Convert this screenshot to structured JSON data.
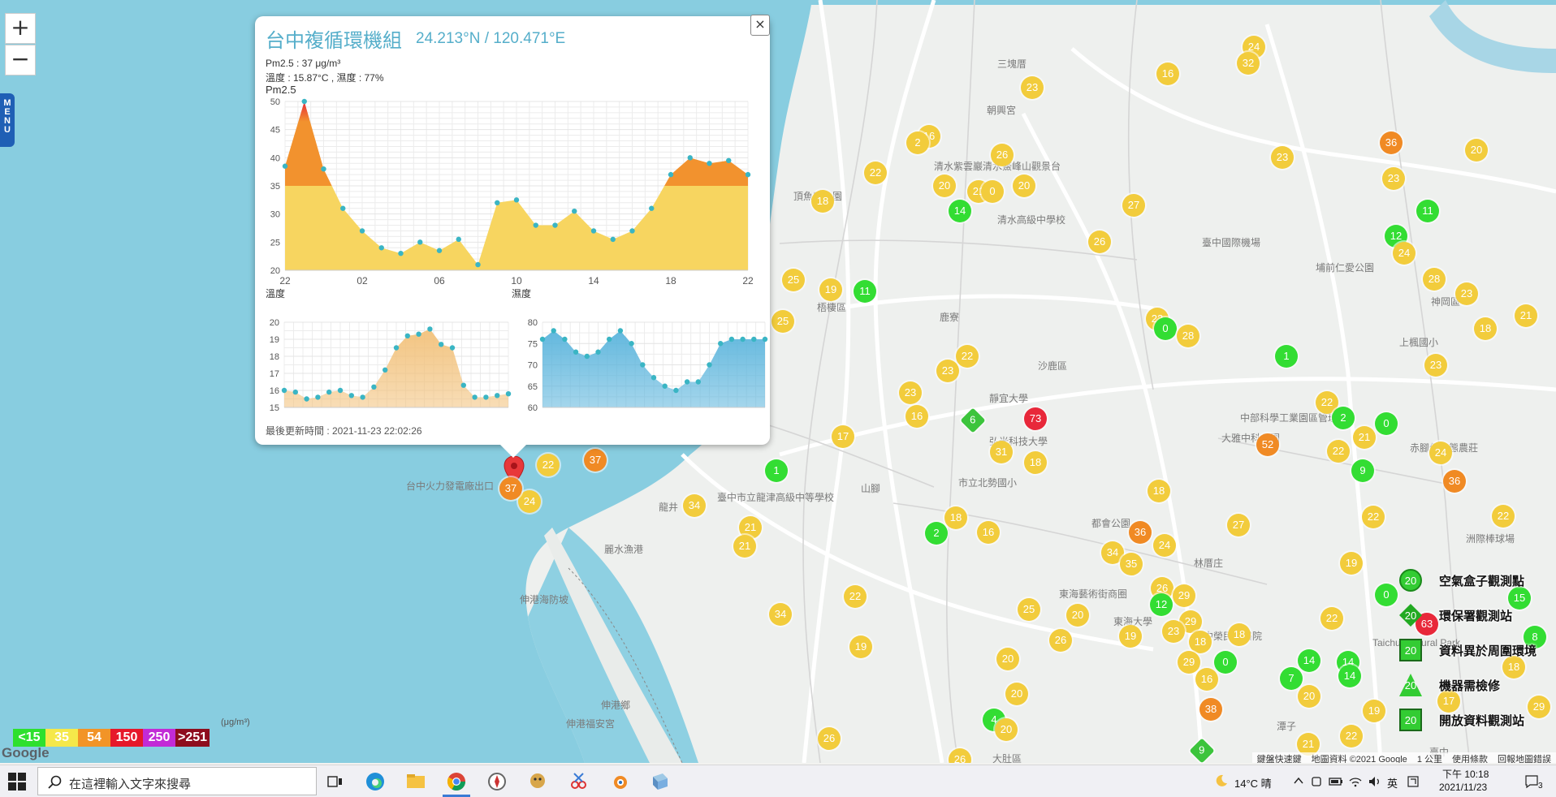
{
  "map": {
    "zoom_in": "+",
    "zoom_out": "−",
    "menu_tab": "MENU",
    "places": [
      {
        "t": "三塊厝",
        "x": 1228,
        "y": 70
      },
      {
        "t": "朝興宮",
        "x": 1215,
        "y": 127
      },
      {
        "t": "清水紫雲巖",
        "x": 1150,
        "y": 196
      },
      {
        "t": "清水鰲峰山觀景台",
        "x": 1210,
        "y": 196
      },
      {
        "t": "頂魚寮公園",
        "x": 977,
        "y": 233
      },
      {
        "t": "清水高級中學校",
        "x": 1228,
        "y": 262
      },
      {
        "t": "梧棲區",
        "x": 1006,
        "y": 370
      },
      {
        "t": "鹿寮",
        "x": 1157,
        "y": 382
      },
      {
        "t": "沙鹿區",
        "x": 1278,
        "y": 442
      },
      {
        "t": "靜宜大學",
        "x": 1218,
        "y": 482
      },
      {
        "t": "弘光科技大學",
        "x": 1218,
        "y": 535
      },
      {
        "t": "市立北勢國小",
        "x": 1180,
        "y": 586
      },
      {
        "t": "臺中國際機場",
        "x": 1480,
        "y": 290
      },
      {
        "t": "埔前仁愛公園",
        "x": 1620,
        "y": 321
      },
      {
        "t": "神岡區",
        "x": 1762,
        "y": 363
      },
      {
        "t": "上楓國小",
        "x": 1723,
        "y": 413
      },
      {
        "t": "中部科學工業園區管理局",
        "x": 1527,
        "y": 506
      },
      {
        "t": "大雅中科公園",
        "x": 1504,
        "y": 531
      },
      {
        "t": "赤腳仔生態農莊",
        "x": 1736,
        "y": 543
      },
      {
        "t": "台中火力發電廠出口",
        "x": 500,
        "y": 590
      },
      {
        "t": "龍井",
        "x": 811,
        "y": 616
      },
      {
        "t": "臺中市立龍津高級中等學校",
        "x": 883,
        "y": 604
      },
      {
        "t": "山腳",
        "x": 1060,
        "y": 593
      },
      {
        "t": "都會公園",
        "x": 1344,
        "y": 636
      },
      {
        "t": "麗水漁港",
        "x": 744,
        "y": 668
      },
      {
        "t": "林厝庄",
        "x": 1470,
        "y": 685
      },
      {
        "t": "洲際棒球場",
        "x": 1805,
        "y": 655
      },
      {
        "t": "東海藝術街商圈",
        "x": 1304,
        "y": 723
      },
      {
        "t": "東海大學",
        "x": 1371,
        "y": 757
      },
      {
        "t": "臺中榮民總醫院",
        "x": 1470,
        "y": 775
      },
      {
        "t": "Taichung Rural Park",
        "x": 1690,
        "y": 785
      },
      {
        "t": "伸港海防坡",
        "x": 640,
        "y": 730
      },
      {
        "t": "伸港鄉",
        "x": 740,
        "y": 860
      },
      {
        "t": "伸港福安宮",
        "x": 697,
        "y": 883
      },
      {
        "t": "大肚區",
        "x": 1222,
        "y": 926
      },
      {
        "t": "潭子",
        "x": 1572,
        "y": 886
      },
      {
        "t": "臺中",
        "x": 1760,
        "y": 918
      }
    ],
    "markers": [
      {
        "v": "24",
        "c": "y",
        "x": 1544,
        "y": 58
      },
      {
        "v": "32",
        "c": "y",
        "x": 1537,
        "y": 78
      },
      {
        "v": "16",
        "c": "y",
        "x": 1438,
        "y": 91
      },
      {
        "v": "23",
        "c": "y",
        "x": 1271,
        "y": 108
      },
      {
        "v": "16",
        "c": "y",
        "x": 1144,
        "y": 168
      },
      {
        "v": "2",
        "c": "y",
        "x": 1130,
        "y": 176
      },
      {
        "v": "26",
        "c": "y",
        "x": 1234,
        "y": 191
      },
      {
        "v": "36",
        "c": "o",
        "x": 1713,
        "y": 176
      },
      {
        "v": "20",
        "c": "y",
        "x": 1818,
        "y": 185
      },
      {
        "v": "23",
        "c": "y",
        "x": 1579,
        "y": 194
      },
      {
        "v": "22",
        "c": "y",
        "x": 1078,
        "y": 213
      },
      {
        "v": "20",
        "c": "y",
        "x": 1163,
        "y": 229
      },
      {
        "v": "21",
        "c": "y",
        "x": 1205,
        "y": 236
      },
      {
        "v": "0",
        "c": "y",
        "x": 1222,
        "y": 236
      },
      {
        "v": "20",
        "c": "y",
        "x": 1261,
        "y": 229
      },
      {
        "v": "23",
        "c": "y",
        "x": 1716,
        "y": 220
      },
      {
        "v": "18",
        "c": "y",
        "x": 1013,
        "y": 248
      },
      {
        "v": "14",
        "c": "g",
        "x": 1182,
        "y": 260
      },
      {
        "v": "27",
        "c": "y",
        "x": 1396,
        "y": 253
      },
      {
        "v": "11",
        "c": "g",
        "x": 1758,
        "y": 260
      },
      {
        "v": "26",
        "c": "y",
        "x": 1354,
        "y": 298
      },
      {
        "v": "12",
        "c": "g",
        "x": 1719,
        "y": 291
      },
      {
        "v": "24",
        "c": "y",
        "x": 1729,
        "y": 312
      },
      {
        "v": "28",
        "c": "y",
        "x": 1766,
        "y": 344
      },
      {
        "v": "23",
        "c": "y",
        "x": 1806,
        "y": 362
      },
      {
        "v": "21",
        "c": "y",
        "x": 1879,
        "y": 389
      },
      {
        "v": "18",
        "c": "y",
        "x": 1829,
        "y": 405
      },
      {
        "v": "25",
        "c": "y",
        "x": 977,
        "y": 345
      },
      {
        "v": "19",
        "c": "y",
        "x": 1023,
        "y": 357
      },
      {
        "v": "11",
        "c": "g",
        "x": 1065,
        "y": 359
      },
      {
        "v": "25",
        "c": "y",
        "x": 964,
        "y": 396
      },
      {
        "v": "22",
        "c": "y",
        "x": 1425,
        "y": 393
      },
      {
        "v": "0",
        "c": "g",
        "x": 1435,
        "y": 405
      },
      {
        "v": "28",
        "c": "y",
        "x": 1463,
        "y": 414
      },
      {
        "v": "1",
        "c": "g",
        "x": 1584,
        "y": 439
      },
      {
        "v": "22",
        "c": "y",
        "x": 1191,
        "y": 439
      },
      {
        "v": "23",
        "c": "y",
        "x": 1167,
        "y": 457
      },
      {
        "v": "23",
        "c": "y",
        "x": 1768,
        "y": 450
      },
      {
        "v": "23",
        "c": "y",
        "x": 1121,
        "y": 484
      },
      {
        "v": "22",
        "c": "y",
        "x": 1634,
        "y": 496
      },
      {
        "v": "16",
        "c": "y",
        "x": 1129,
        "y": 513
      },
      {
        "v": "2",
        "c": "g",
        "x": 1654,
        "y": 515
      },
      {
        "v": "0",
        "c": "g",
        "x": 1707,
        "y": 522
      },
      {
        "v": "73",
        "c": "r",
        "x": 1275,
        "y": 516
      },
      {
        "v": "21",
        "c": "y",
        "x": 1680,
        "y": 539
      },
      {
        "v": "52",
        "c": "o",
        "x": 1561,
        "y": 548
      },
      {
        "v": "17",
        "c": "y",
        "x": 1038,
        "y": 538
      },
      {
        "v": "22",
        "c": "y",
        "x": 1648,
        "y": 556
      },
      {
        "v": "24",
        "c": "y",
        "x": 1774,
        "y": 558
      },
      {
        "v": "31",
        "c": "y",
        "x": 1233,
        "y": 557
      },
      {
        "v": "18",
        "c": "y",
        "x": 1275,
        "y": 570
      },
      {
        "v": "9",
        "c": "g",
        "x": 1678,
        "y": 580
      },
      {
        "v": "36",
        "c": "o",
        "x": 1791,
        "y": 593
      },
      {
        "v": "1",
        "c": "g",
        "x": 956,
        "y": 580
      },
      {
        "v": "22",
        "c": "y",
        "x": 675,
        "y": 573
      },
      {
        "v": "37",
        "c": "o",
        "x": 733,
        "y": 567
      },
      {
        "v": "18",
        "c": "y",
        "x": 1427,
        "y": 605
      },
      {
        "v": "22",
        "c": "y",
        "x": 1691,
        "y": 637
      },
      {
        "v": "22",
        "c": "y",
        "x": 1851,
        "y": 636
      },
      {
        "v": "34",
        "c": "y",
        "x": 855,
        "y": 623
      },
      {
        "v": "24",
        "c": "y",
        "x": 652,
        "y": 618
      },
      {
        "v": "18",
        "c": "y",
        "x": 1177,
        "y": 638
      },
      {
        "v": "27",
        "c": "y",
        "x": 1525,
        "y": 647
      },
      {
        "v": "36",
        "c": "o",
        "x": 1404,
        "y": 656
      },
      {
        "v": "21",
        "c": "y",
        "x": 924,
        "y": 650
      },
      {
        "v": "2",
        "c": "g",
        "x": 1153,
        "y": 657
      },
      {
        "v": "16",
        "c": "y",
        "x": 1217,
        "y": 656
      },
      {
        "v": "21",
        "c": "y",
        "x": 917,
        "y": 673
      },
      {
        "v": "34",
        "c": "y",
        "x": 1370,
        "y": 681
      },
      {
        "v": "24",
        "c": "y",
        "x": 1434,
        "y": 672
      },
      {
        "v": "35",
        "c": "y",
        "x": 1393,
        "y": 695
      },
      {
        "v": "19",
        "c": "y",
        "x": 1664,
        "y": 694
      },
      {
        "v": "26",
        "c": "y",
        "x": 1431,
        "y": 725
      },
      {
        "v": "29",
        "c": "y",
        "x": 1458,
        "y": 734
      },
      {
        "v": "0",
        "c": "g",
        "x": 1707,
        "y": 733
      },
      {
        "v": "15",
        "c": "g",
        "x": 1871,
        "y": 737
      },
      {
        "v": "22",
        "c": "y",
        "x": 1053,
        "y": 735
      },
      {
        "v": "12",
        "c": "g",
        "x": 1430,
        "y": 745
      },
      {
        "v": "25",
        "c": "y",
        "x": 1267,
        "y": 751
      },
      {
        "v": "20",
        "c": "y",
        "x": 1327,
        "y": 758
      },
      {
        "v": "29",
        "c": "y",
        "x": 1466,
        "y": 766
      },
      {
        "v": "22",
        "c": "y",
        "x": 1640,
        "y": 762
      },
      {
        "v": "34",
        "c": "y",
        "x": 961,
        "y": 757
      },
      {
        "v": "23",
        "c": "y",
        "x": 1445,
        "y": 778
      },
      {
        "v": "19",
        "c": "y",
        "x": 1392,
        "y": 784
      },
      {
        "v": "18",
        "c": "y",
        "x": 1478,
        "y": 791
      },
      {
        "v": "18",
        "c": "y",
        "x": 1526,
        "y": 782
      },
      {
        "v": "26",
        "c": "y",
        "x": 1306,
        "y": 789
      },
      {
        "v": "63",
        "c": "r",
        "x": 1757,
        "y": 769
      },
      {
        "v": "8",
        "c": "g",
        "x": 1890,
        "y": 785
      },
      {
        "v": "19",
        "c": "y",
        "x": 1060,
        "y": 797
      },
      {
        "v": "20",
        "c": "y",
        "x": 1241,
        "y": 812
      },
      {
        "v": "29",
        "c": "y",
        "x": 1464,
        "y": 816
      },
      {
        "v": "0",
        "c": "g",
        "x": 1509,
        "y": 816
      },
      {
        "v": "14",
        "c": "g",
        "x": 1612,
        "y": 814
      },
      {
        "v": "14",
        "c": "g",
        "x": 1660,
        "y": 816
      },
      {
        "v": "7",
        "c": "g",
        "x": 1590,
        "y": 836
      },
      {
        "v": "14",
        "c": "g",
        "x": 1662,
        "y": 833
      },
      {
        "v": "16",
        "c": "y",
        "x": 1486,
        "y": 837
      },
      {
        "v": "18",
        "c": "y",
        "x": 1864,
        "y": 822
      },
      {
        "v": "38",
        "c": "o",
        "x": 1491,
        "y": 874
      },
      {
        "v": "20",
        "c": "y",
        "x": 1252,
        "y": 855
      },
      {
        "v": "20",
        "c": "y",
        "x": 1612,
        "y": 858
      },
      {
        "v": "17",
        "c": "y",
        "x": 1784,
        "y": 864
      },
      {
        "v": "29",
        "c": "y",
        "x": 1895,
        "y": 871
      },
      {
        "v": "19",
        "c": "y",
        "x": 1692,
        "y": 876
      },
      {
        "v": "4",
        "c": "g",
        "x": 1224,
        "y": 887
      },
      {
        "v": "20",
        "c": "y",
        "x": 1239,
        "y": 899
      },
      {
        "v": "22",
        "c": "y",
        "x": 1664,
        "y": 907
      },
      {
        "v": "21",
        "c": "y",
        "x": 1611,
        "y": 917
      },
      {
        "v": "26",
        "c": "y",
        "x": 1021,
        "y": 910
      },
      {
        "v": "26",
        "c": "y",
        "x": 1182,
        "y": 936
      }
    ],
    "diamond_markers": [
      {
        "v": "6",
        "x": 1198,
        "y": 518
      },
      {
        "v": "9",
        "x": 1480,
        "y": 925
      }
    ],
    "selected_station": {
      "v": "37",
      "x": 629,
      "y": 602
    }
  },
  "popup": {
    "close": "×",
    "station_name": "台中複循環機組",
    "coords": "24.213°N / 120.471°E",
    "pm25_line": "Pm2.5 : 37 μg/m³",
    "weather_line": "溫度 : 15.87°C , 濕度 : 77%",
    "chart_title": "Pm2.5",
    "updated": "最後更新時間 : 2021-11-23 22:02:26"
  },
  "chart_data": [
    {
      "type": "area",
      "title": "Pm2.5",
      "x_ticks": [
        "22",
        "02",
        "06",
        "10",
        "14",
        "18",
        "22"
      ],
      "ylim": [
        20,
        50
      ],
      "y_ticks": [
        20,
        25,
        30,
        35,
        40,
        45,
        50
      ],
      "threshold": 35,
      "values": [
        38.5,
        50,
        38,
        31,
        27,
        24,
        23,
        25,
        23.5,
        25.5,
        21,
        32,
        32.5,
        28,
        28,
        30.5,
        27,
        25.5,
        27,
        31,
        37,
        40,
        39,
        39.5,
        37
      ],
      "colors": {
        "low": "#f7d560",
        "high": "#f2922e",
        "peak": "#e8283a",
        "point": "#3ab5c4"
      }
    },
    {
      "type": "area",
      "title": "溫度",
      "ylim": [
        15,
        20
      ],
      "y_ticks": [
        15,
        16,
        17,
        18,
        19,
        20
      ],
      "values": [
        16,
        15.9,
        15.5,
        15.6,
        15.9,
        16,
        15.7,
        15.6,
        16.2,
        17.2,
        18.5,
        19.2,
        19.3,
        19.6,
        18.7,
        18.5,
        16.3,
        15.6,
        15.6,
        15.7,
        15.8
      ],
      "colors": {
        "fill": "#f2c17a",
        "point": "#3ab5c4"
      }
    },
    {
      "type": "area",
      "title": "濕度",
      "ylim": [
        60,
        80
      ],
      "y_ticks": [
        60,
        65,
        70,
        75,
        80
      ],
      "values": [
        76,
        78,
        76,
        73,
        72,
        73,
        76,
        78,
        75,
        70,
        67,
        65,
        64,
        66,
        66,
        70,
        75,
        76,
        76,
        76,
        76
      ],
      "colors": {
        "fill": "#5ab4dc",
        "point": "#3ab5c4"
      }
    }
  ],
  "legend_icons": [
    {
      "label": "空氣盒子觀測點",
      "shape": "circle",
      "value": "20"
    },
    {
      "label": "環保署觀測站",
      "shape": "diamond",
      "value": "20"
    },
    {
      "label": "資料異於周圍環境",
      "shape": "square",
      "value": "20"
    },
    {
      "label": "機器需檢修",
      "shape": "triangle",
      "value": "20"
    },
    {
      "label": "開放資料觀測站",
      "shape": "square",
      "value": "20"
    }
  ],
  "scale": {
    "unit": "(μg/m³)",
    "items": [
      {
        "label": "<15",
        "color": "#2ee02e"
      },
      {
        "label": "35",
        "color": "#f5e84a"
      },
      {
        "label": "54",
        "color": "#f29427"
      },
      {
        "label": "150",
        "color": "#e6182a"
      },
      {
        "label": "250",
        "color": "#c22bd6"
      },
      {
        "label": ">251",
        "color": "#8e0d1e"
      }
    ]
  },
  "google_logo": "Google",
  "attribution": [
    "鍵盤快速鍵",
    "地圖資料 ©2021 Google",
    "1 公里",
    "使用條款",
    "回報地圖錯誤"
  ],
  "taskbar": {
    "search_placeholder": "在這裡輸入文字來搜尋",
    "weather": "14°C 晴",
    "ime": "英",
    "time": "下午 10:18",
    "date": "2021/11/23",
    "notifications": "3"
  }
}
